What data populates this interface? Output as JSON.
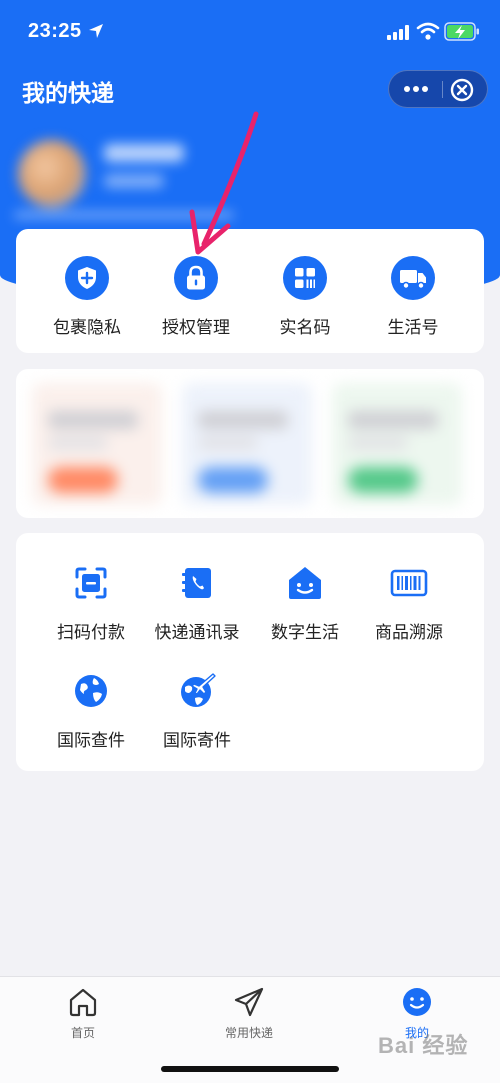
{
  "status_bar": {
    "time": "23:25"
  },
  "header": {
    "title": "我的快递",
    "capsule_more_icon": "more-dots-icon",
    "capsule_close_icon": "close-circle-icon"
  },
  "quick_actions": [
    {
      "label": "包裹隐私",
      "icon": "shield-plus-icon"
    },
    {
      "label": "授权管理",
      "icon": "lock-icon"
    },
    {
      "label": "实名码",
      "icon": "qr-grid-icon"
    },
    {
      "label": "生活号",
      "icon": "truck-icon"
    }
  ],
  "services": [
    {
      "label": "扫码付款",
      "icon": "scan-icon"
    },
    {
      "label": "快递通讯录",
      "icon": "phone-book-icon"
    },
    {
      "label": "数字生活",
      "icon": "smile-house-icon"
    },
    {
      "label": "商品溯源",
      "icon": "barcode-icon"
    },
    {
      "label": "国际查件",
      "icon": "globe-icon"
    },
    {
      "label": "国际寄件",
      "icon": "globe-plane-icon"
    }
  ],
  "tab_bar": [
    {
      "label": "首页",
      "icon": "home-icon",
      "active": false
    },
    {
      "label": "常用快递",
      "icon": "paper-plane-icon",
      "active": false
    },
    {
      "label": "我的",
      "icon": "smile-circle-icon",
      "active": true
    }
  ],
  "watermark": "Bai 经验",
  "colors": {
    "primary": "#1a6ef5",
    "annotation": "#e8236b",
    "background": "#f2f2f6"
  }
}
